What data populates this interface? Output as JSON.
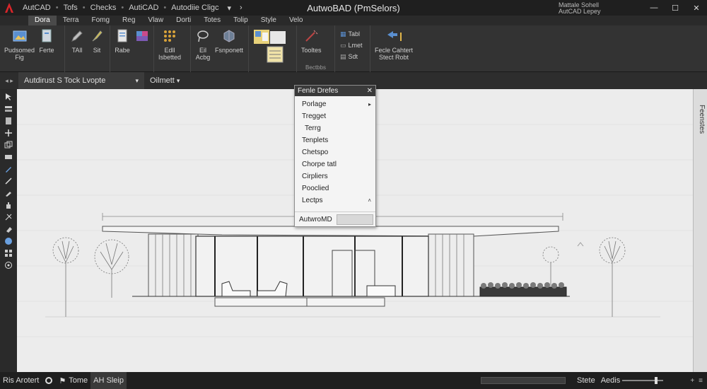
{
  "window": {
    "title": "AutwoBAD (PmSelors)",
    "user_line1": "Mattale Sohell",
    "user_line2": "AutCAD Lepey"
  },
  "quick_access": [
    "AutCAD",
    "Tofs",
    "Checks",
    "AutiCAD",
    "Autodiie Cligc"
  ],
  "ribbon_tabs": [
    {
      "label": "Dora",
      "active": true
    },
    {
      "label": "Terra",
      "active": false
    },
    {
      "label": "Fomg",
      "active": false
    },
    {
      "label": "Reg",
      "active": false
    },
    {
      "label": "Vlaw",
      "active": false
    },
    {
      "label": "Dorti",
      "active": false
    },
    {
      "label": "Totes",
      "active": false
    },
    {
      "label": "Tolip",
      "active": false
    },
    {
      "label": "Style",
      "active": false
    },
    {
      "label": "Velo",
      "active": false
    }
  ],
  "ribbon": {
    "g1": {
      "tool1": "Pudsomed",
      "tool1b": "Fig",
      "tool2": "Ferte"
    },
    "g2": {
      "tool1": "TAll",
      "tool2": "Sit"
    },
    "g3": {
      "tool1": "Rabe"
    },
    "g4": {
      "tool1": "Edll",
      "tool2": "Isbetted"
    },
    "g5": {
      "tool1": "Eil",
      "tool1b": "Acbg",
      "tool2": "Fsnponett"
    },
    "g7": {
      "tool1": "Tooltes",
      "title": "Bectbbs"
    },
    "g8": {
      "small1": "Tabl",
      "small2": "Lmet",
      "small3": "Sdt"
    },
    "g9": {
      "tool1": "Fecle Cahtert",
      "tool1b": "Stect Robt"
    }
  },
  "doc_tabs": {
    "active": "Autdirust S Tock Lvopte",
    "second": "Oilmett"
  },
  "menu": {
    "title": "Fenle Drefes",
    "items": [
      {
        "label": "Porlage",
        "submenu": true
      },
      {
        "label": "Tregget",
        "submenu": false
      },
      {
        "label": "Terrg",
        "submenu": false
      },
      {
        "label": "Tenplets",
        "submenu": false
      },
      {
        "label": "Chetspo",
        "submenu": false
      },
      {
        "label": "Chorpe tatl",
        "submenu": false
      },
      {
        "label": "Cirpliers",
        "submenu": false
      },
      {
        "label": "Pooclied",
        "submenu": false
      },
      {
        "label": "Lectps",
        "submenu": true
      }
    ],
    "footer_label": "AutwroMD"
  },
  "right_panel": {
    "label": "Feenstes"
  },
  "statusbar": {
    "items": [
      "Ris Arotert",
      "Tome",
      "AH Sleip"
    ],
    "right": [
      "Stete",
      "Aedis"
    ],
    "progress": 0.0
  },
  "colors": {
    "accent_red": "#d9252a",
    "canvas_bg": "#ececec",
    "ui_dark": "#262626"
  }
}
